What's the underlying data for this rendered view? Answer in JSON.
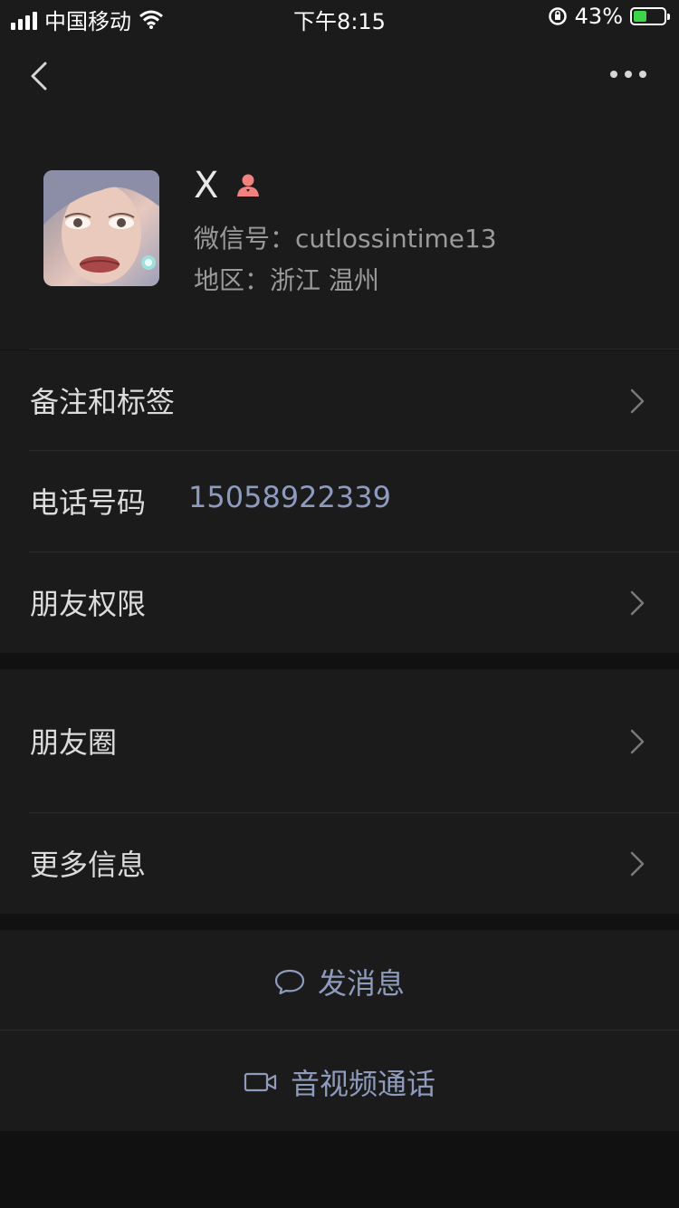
{
  "status_bar": {
    "carrier": "中国移动",
    "time": "下午8:15",
    "battery_percent": "43%",
    "battery_level": 0.43
  },
  "profile": {
    "name": "X",
    "wechat_id": "微信号：cutlossintime13",
    "region": "地区：浙江 温州"
  },
  "rows": {
    "notes_tags": "备注和标签",
    "phone_label": "电话号码",
    "phone_value": "15058922339",
    "permissions": "朋友权限",
    "moments": "朋友圈",
    "more_info": "更多信息"
  },
  "actions": {
    "send_message": "发消息",
    "video_call": "音视频通话"
  },
  "colors": {
    "background": "#111111",
    "card": "#1b1b1b",
    "accent_link": "#8e9bbd",
    "battery_green": "#3dd44a"
  }
}
